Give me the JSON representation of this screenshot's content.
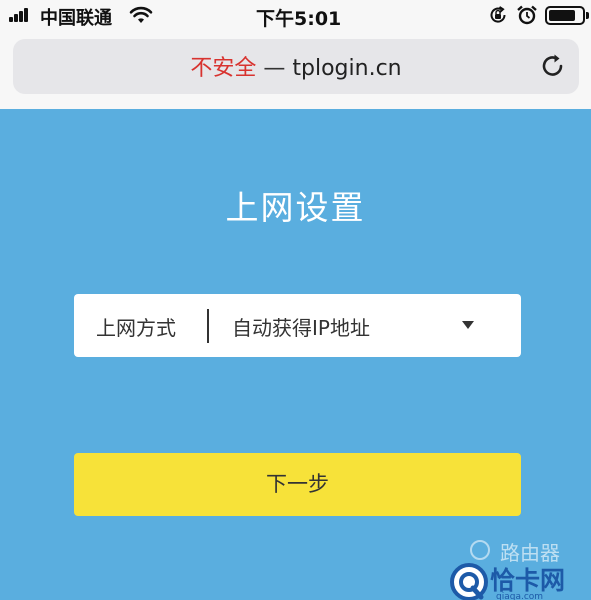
{
  "status_bar": {
    "carrier": "中国联通",
    "time": "下午5:01",
    "battery_level": 0.8
  },
  "browser": {
    "security_text": "不安全",
    "separator": "—",
    "domain": "tplogin.cn"
  },
  "page": {
    "title": "上网设置",
    "connection": {
      "label": "上网方式",
      "selected_value": "自动获得IP地址"
    },
    "next_button": "下一步"
  },
  "watermark": {
    "faint_text": "路由器",
    "logo_text": "恰卡网",
    "logo_url": "qiaqa.com"
  },
  "colors": {
    "content_bg": "#5aaedf",
    "button_bg": "#f7e239",
    "insecure_text": "#d8332f",
    "watermark_blue": "#1d5aa8"
  },
  "icons": [
    "signal-icon",
    "wifi-icon",
    "rotation-lock-icon",
    "alarm-icon",
    "battery-icon",
    "reload-icon",
    "dropdown-caret-icon",
    "watermark-logo-icon"
  ]
}
